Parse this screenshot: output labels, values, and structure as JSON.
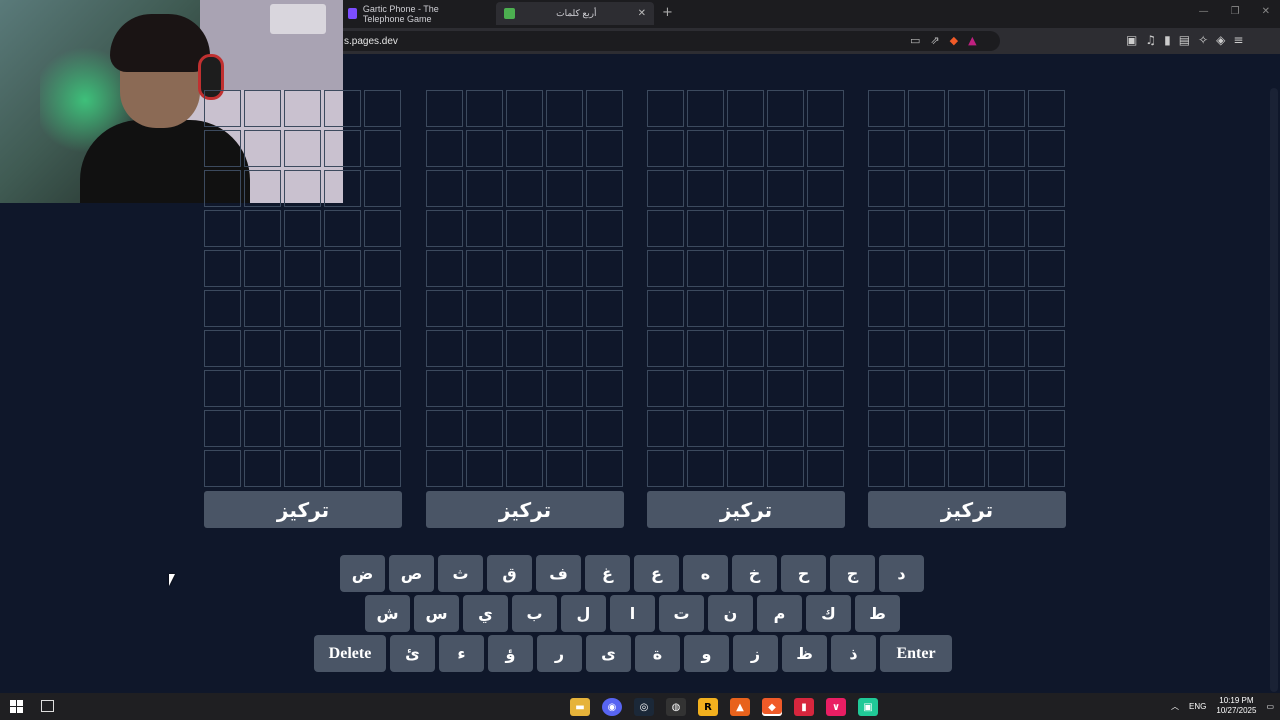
{
  "browser": {
    "tabs": [
      {
        "title": "Gartic Phone - The Telephone Game",
        "active": false
      },
      {
        "title": "أربع كلمات",
        "active": true
      }
    ],
    "url": "s.pages.dev"
  },
  "boards": [
    {
      "rows": 10,
      "cols": 5,
      "focus_label": "تركيز"
    },
    {
      "rows": 10,
      "cols": 5,
      "focus_label": "تركيز"
    },
    {
      "rows": 10,
      "cols": 5,
      "focus_label": "تركيز"
    },
    {
      "rows": 10,
      "cols": 5,
      "focus_label": "تركيز"
    }
  ],
  "keyboard": {
    "row1": [
      "ض",
      "ص",
      "ث",
      "ق",
      "ف",
      "غ",
      "ع",
      "ه",
      "خ",
      "ح",
      "ج",
      "د"
    ],
    "row2": [
      "ش",
      "س",
      "ي",
      "ب",
      "ل",
      "ا",
      "ت",
      "ن",
      "م",
      "ك",
      "ط"
    ],
    "row3": [
      "Delete",
      "ئ",
      "ء",
      "ؤ",
      "ر",
      "ى",
      "ة",
      "و",
      "ز",
      "ظ",
      "ذ",
      "Enter"
    ]
  },
  "taskbar": {
    "language": "ENG",
    "time": "10:19 PM",
    "date": "10/27/2025"
  },
  "colors": {
    "page_bg": "#0f172a",
    "cell_border": "#3c4a5e",
    "key_bg": "#4a5566"
  }
}
